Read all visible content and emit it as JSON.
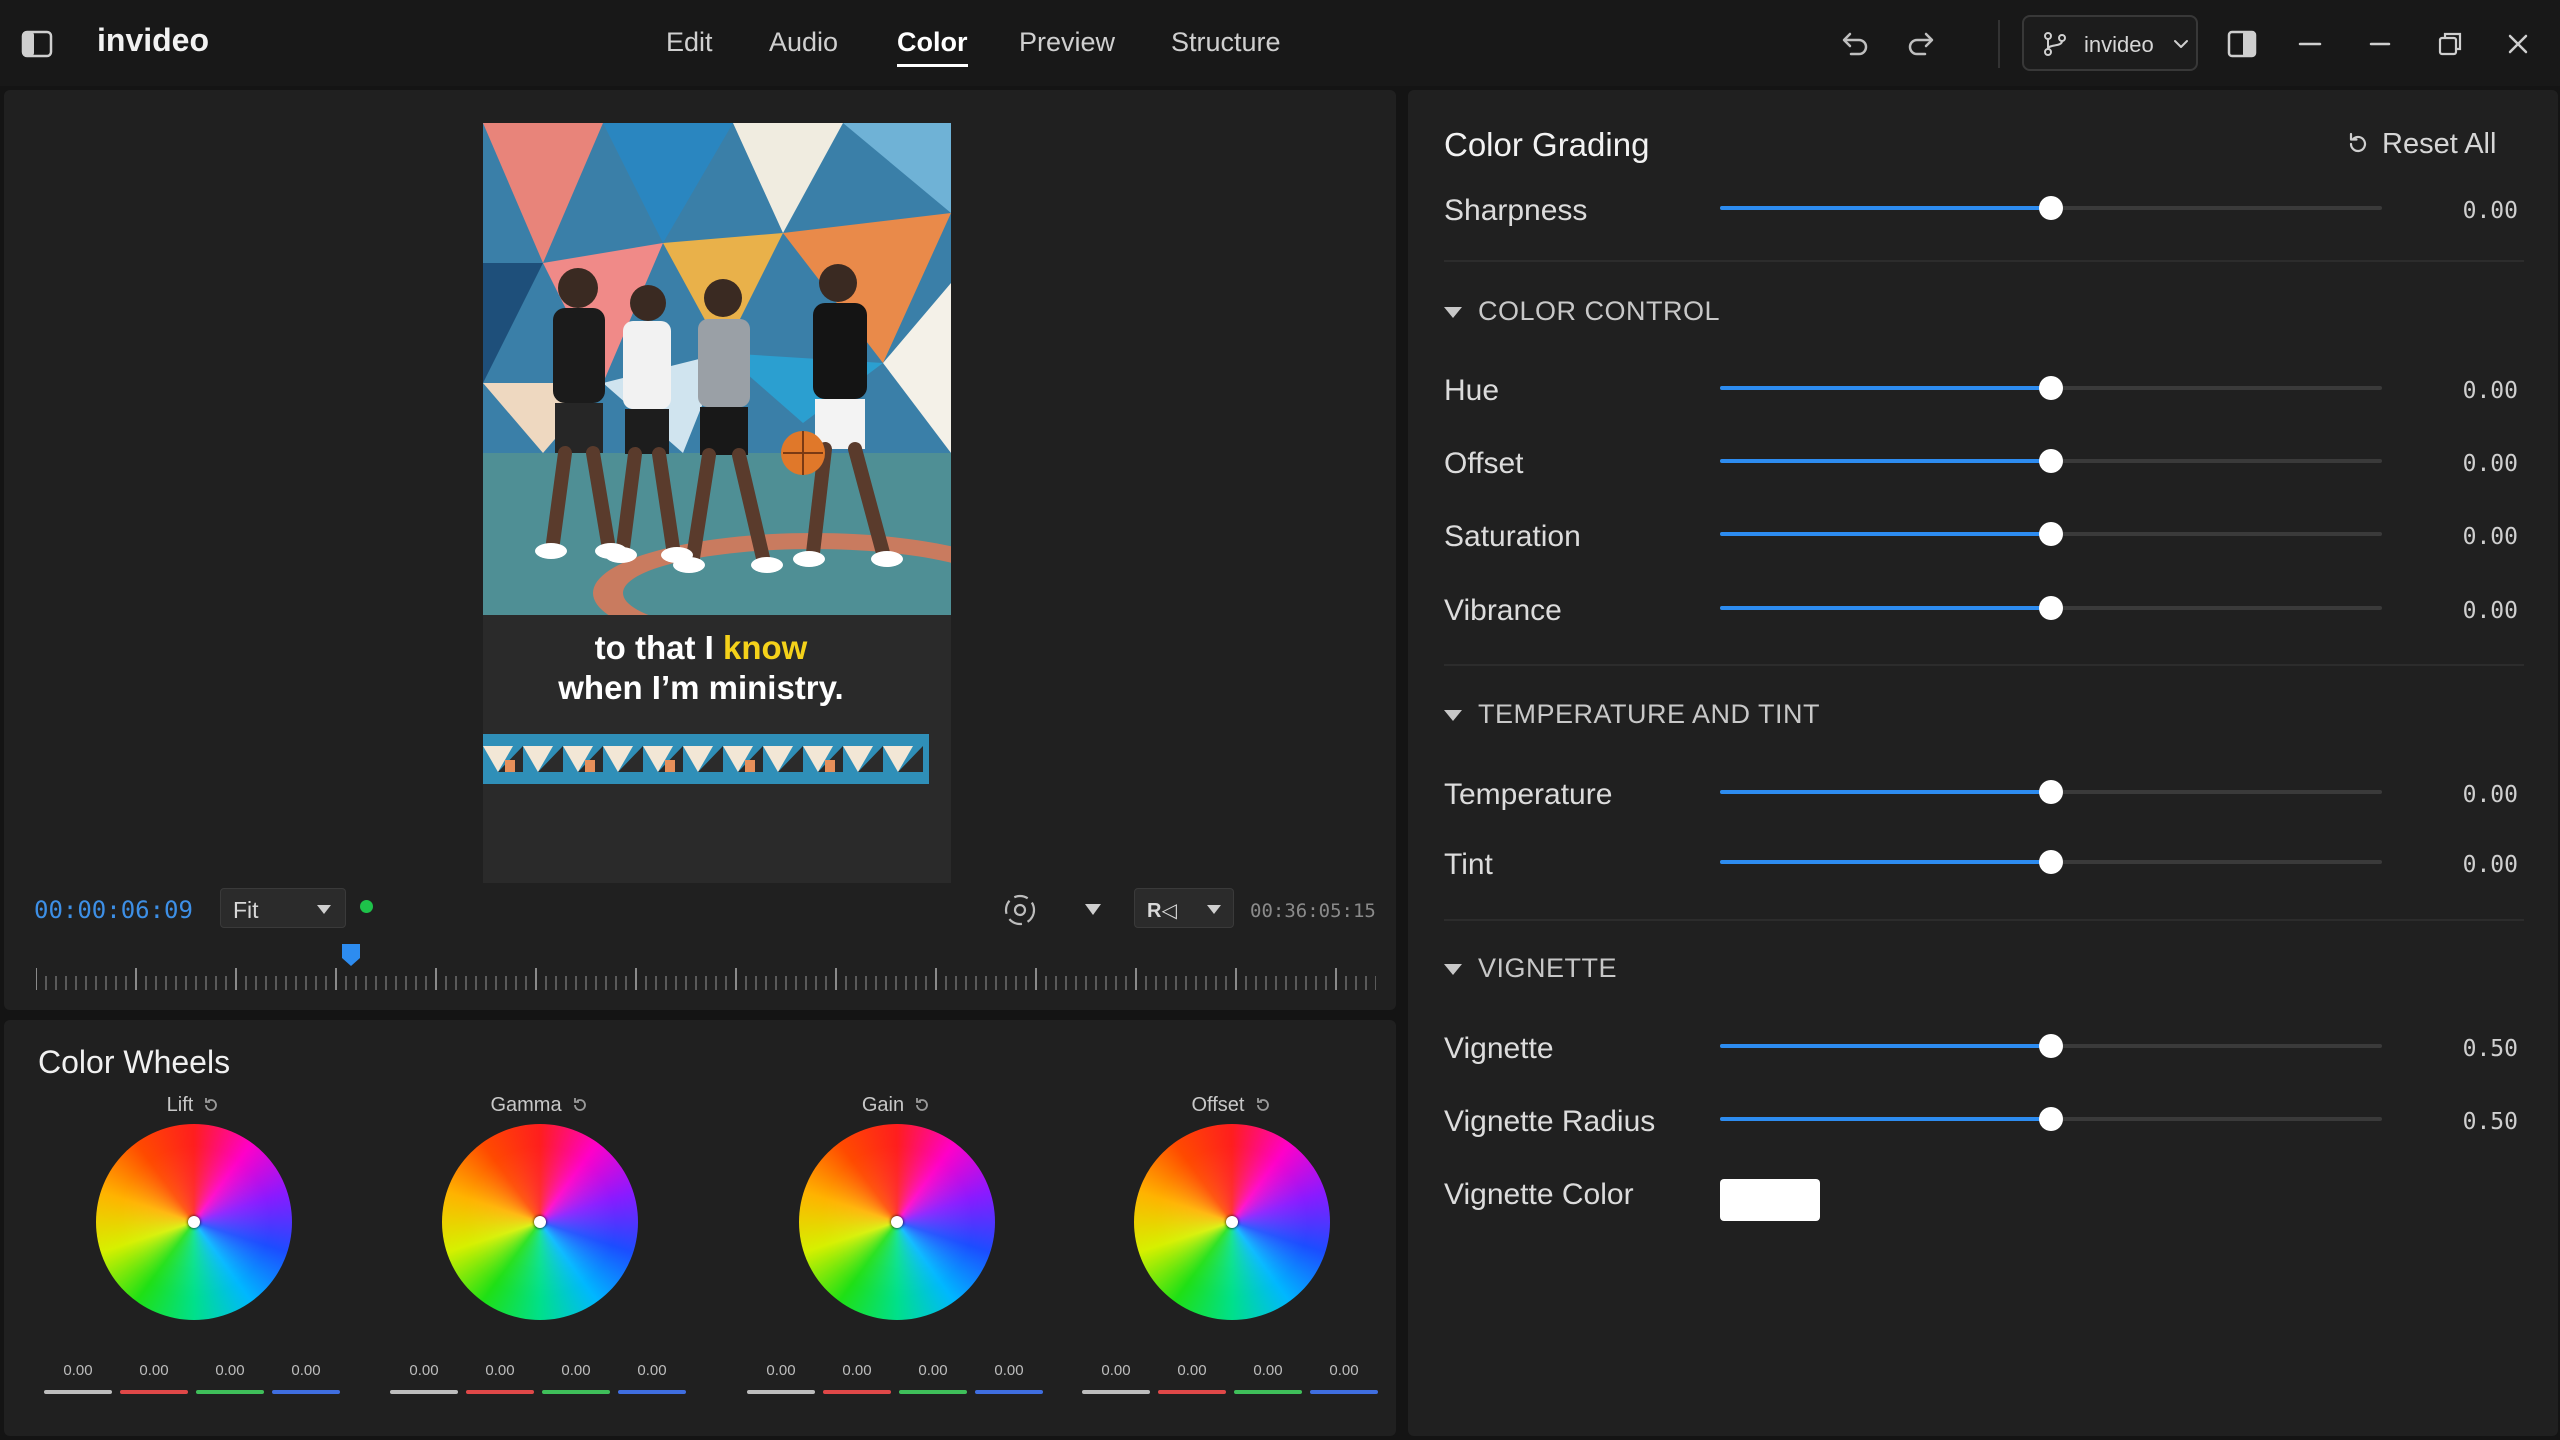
{
  "app": {
    "name": "invideo"
  },
  "tabs": [
    {
      "label": "Edit",
      "active": false
    },
    {
      "label": "Audio",
      "active": false
    },
    {
      "label": "Color",
      "active": true
    },
    {
      "label": "Preview",
      "active": false
    },
    {
      "label": "Structure",
      "active": false
    }
  ],
  "titlebar": {
    "project_label": "invideo",
    "icons": [
      "sidebar-toggle-icon",
      "undo-icon",
      "redo-icon",
      "branch-icon",
      "chevron-down-icon",
      "panel-layout-icon",
      "minimize-icon",
      "minimize-alt-icon",
      "restore-icon",
      "close-icon"
    ]
  },
  "viewer": {
    "caption_line1_prefix": "to that I ",
    "caption_line1_highlight": "know",
    "caption_line2": "when I’m ministry.",
    "timecode": "00:00:06:09",
    "fit": "Fit",
    "playback_mode": "R◁",
    "duration": "00:36:05:15",
    "playhead_fraction": 0.235,
    "colors": {
      "timecode": "#3d8fe6",
      "status_dot": "#1ec24a",
      "caption_highlight": "#f5d21a"
    }
  },
  "color_wheels": {
    "title": "Color Wheels",
    "wheels": [
      {
        "label": "Lift",
        "values": [
          "0.00",
          "0.00",
          "0.00",
          "0.00"
        ]
      },
      {
        "label": "Gamma",
        "values": [
          "0.00",
          "0.00",
          "0.00",
          "0.00"
        ]
      },
      {
        "label": "Gain",
        "values": [
          "0.00",
          "0.00",
          "0.00",
          "0.00"
        ]
      },
      {
        "label": "Offset",
        "values": [
          "0.00",
          "0.00",
          "0.00",
          "0.00"
        ]
      }
    ],
    "channel_colors": [
      "#bdbdbd",
      "#e04848",
      "#3fbf5a",
      "#3f6ee0"
    ]
  },
  "color_grading": {
    "title": "Color Grading",
    "reset_all": "Reset All",
    "sharpness": {
      "label": "Sharpness",
      "value": "0.00",
      "fraction": 0.5
    },
    "sections": [
      {
        "title": "COLOR CONTROL",
        "rows": [
          {
            "label": "Hue",
            "value": "0.00",
            "fraction": 0.5
          },
          {
            "label": "Offset",
            "value": "0.00",
            "fraction": 0.5
          },
          {
            "label": "Saturation",
            "value": "0.00",
            "fraction": 0.5
          },
          {
            "label": "Vibrance",
            "value": "0.00",
            "fraction": 0.5
          }
        ]
      },
      {
        "title": "TEMPERATURE AND TINT",
        "rows": [
          {
            "label": "Temperature",
            "value": "0.00",
            "fraction": 0.5
          },
          {
            "label": "Tint",
            "value": "0.00",
            "fraction": 0.5
          }
        ]
      },
      {
        "title": "VIGNETTE",
        "rows": [
          {
            "label": "Vignette",
            "value": "0.50",
            "fraction": 0.5
          },
          {
            "label": "Vignette Radius",
            "value": "0.50",
            "fraction": 0.5
          }
        ],
        "color_row": {
          "label": "Vignette Color",
          "color": "#ffffff"
        }
      }
    ],
    "accent": "#2d8cf0"
  }
}
